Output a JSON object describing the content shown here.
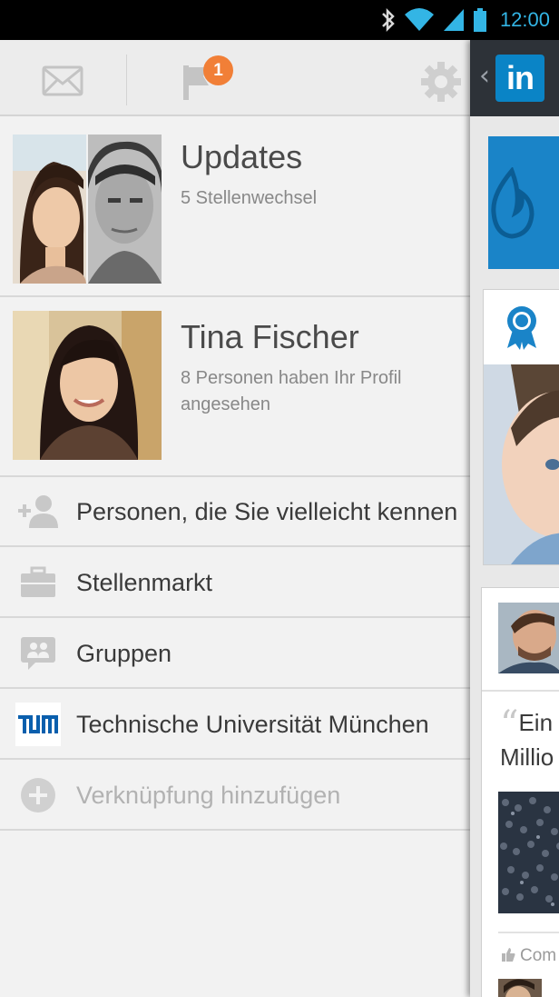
{
  "status_bar": {
    "time": "12:00",
    "icons": [
      "bluetooth-icon",
      "wifi-icon",
      "signal-icon",
      "battery-icon"
    ],
    "accent_color": "#33b5e5"
  },
  "drawer": {
    "topbar": {
      "icons": [
        "mail-icon",
        "flag-icon",
        "gear-icon"
      ],
      "notification_count": "1",
      "badge_color": "#f17f37"
    },
    "updates": {
      "title": "Updates",
      "subtitle": "5 Stellenwechsel"
    },
    "profile": {
      "title": "Tina Fischer",
      "subtitle": "8 Personen haben Ihr Profil angesehen"
    },
    "nav_items": [
      {
        "label": "Personen, die Sie vielleicht kennen",
        "icon": "add-person-icon"
      },
      {
        "label": "Stellenmarkt",
        "icon": "briefcase-icon"
      },
      {
        "label": "Gruppen",
        "icon": "groups-icon"
      },
      {
        "label": "Technische Universität München",
        "icon": "tum-logo-icon"
      },
      {
        "label": "Verknüpfung hinzufügen",
        "icon": "add-circle-icon"
      }
    ]
  },
  "main": {
    "logo_text": "in",
    "back_glyph": "‹",
    "brand_color": "#0a84c6",
    "post": {
      "quote_mark": "“",
      "quote_line1": "Ein",
      "quote_line2": "Millio",
      "action_label": "Com"
    }
  }
}
